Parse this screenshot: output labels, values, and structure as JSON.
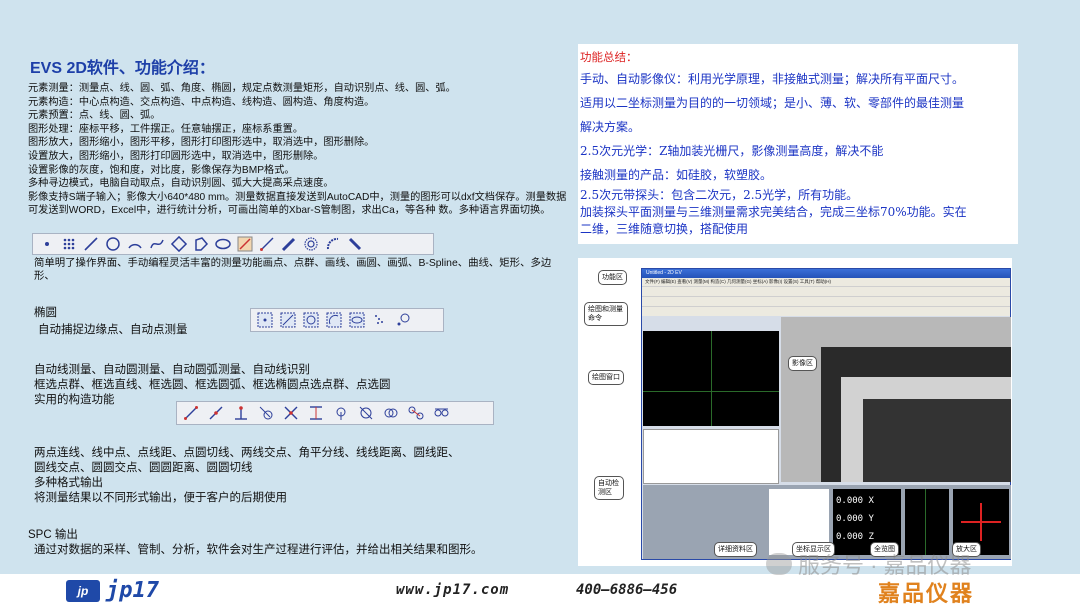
{
  "left": {
    "title": "EVS 2D软件、功能介绍：",
    "specs": [
      "元素测量：测量点、线、圆、弧、角度、椭圆，规定点数测量矩形，自动识别点、线、圆、弧。",
      "元素构造：中心点构造、交点构造、中点构造、线构造、圆构造、角度构造。",
      "元素预置：点、线、圆、弧。",
      "图形处理：座标平移，工件摆正。任意轴摆正，座标系重置。",
      "图形放大，图形缩小，图形平移，图形打印图形选中，取消选中，图形删除。",
      "设置放大，图形缩小，图形打印圆形选中，取消选中，图形删除。",
      "设置影像的灰度，饱和度，对比度，影像保存为BMP格式。",
      "多种寻边模式，电脑自动取点，自动识别圆、弧大大提高采点速度。",
      "影像支持S端子输入；影像大小640*480 mm。测量数据直接发送到AutoCAD中，测量的图形可以dxf文档保存。测量数据可发送到WORD，Excel中，进行统计分析，可画出简单的Xbar-S管制图，求出Ca，等各种 数。多种语言界面切换。"
    ],
    "ops_text": "简单明了操作界面、手动编程灵活丰富的测量功能画点、点群、画线、画圆、画弧、B-Spline、曲线、矩形、多边形、",
    "ellipse_title": "椭圆",
    "ellipse_desc": "自动捕捉边缘点、自动点测量",
    "construct_lines": [
      "自动线测量、自动圆测量、自动圆弧测量、自动线识别",
      "框选点群、框选直线、框选圆、框选圆弧、框选椭圆点选点群、点选圆",
      "实用的构造功能"
    ],
    "distance_lines": [
      "两点连线、线中点、点线距、点圆切线、两线交点、角平分线、线线距离、圆线距、",
      "圆线交点、圆圆交点、圆圆距离、圆圆切线"
    ],
    "output_title": "多种格式输出",
    "output_desc": "将测量结果以不同形式输出，便于客户的后期使用",
    "spc_title": "SPC 输出",
    "spc_desc": "通过对数据的采样、管制、分析，软件会对生产过程进行评估，并给出相关结果和图形。"
  },
  "right": {
    "summary_title": "功能总结：",
    "lines": [
      "手动、自动影像仪：利用光学原理，非接触式测量；解决所有平面尺寸。",
      "适用以二坐标测量为目的的一切领域；是小、薄、软、零部件的最佳测量",
      "解决方案。",
      "2.5次元光学：Z轴加装光栅尺，影像测量高度，解决不能",
      "接触测量的产品：如硅胶，软塑胶。",
      "2.5次元带探头：包含二次元，2.5光学，所有功能。",
      "加装探头平面测量与三维测量需求完美结合，完成三坐标70%功能。实在",
      "二维，三维随意切换，搭配使用"
    ]
  },
  "screenshot": {
    "window_title": "Untitled - 2D EV",
    "menu": "文件(F)  编辑(E)  查看(V)  测量(M)  构造(C)  几何测量(G)  坐标(A)  影像(I)  设置(S)  工具(T)  帮助(H)",
    "coords": [
      "0.000",
      "0.000",
      "0.000"
    ],
    "axis_labels": [
      "X",
      "Y",
      "Z"
    ],
    "callouts": {
      "func": "功能区",
      "draw_cmd": "绘图和测量命令",
      "draw_win": "绘图窗口",
      "auto_detect": "自动检测区",
      "image": "影像区",
      "detail": "详细资料区",
      "coord_disp": "坐标显示区",
      "full": "全览图",
      "zoom": "放大区"
    }
  },
  "footer": {
    "logo_mark": "jp",
    "logo_text": "jp17",
    "website": "www.jp17.com",
    "phone": "400—6886—456",
    "brand": "嘉品仪器",
    "watermark": "服务号 · 嘉品仪器"
  },
  "icons": {
    "toolbar1": [
      "point-icon",
      "point-cloud-icon",
      "line-icon",
      "circle-icon",
      "arc-icon",
      "curve-icon",
      "rectangle-icon",
      "polygon-icon",
      "ellipse-icon",
      "cross-icon",
      "line-measure-icon",
      "pen-icon",
      "ring-icon",
      "arc-auto-icon",
      "probe-icon"
    ],
    "toolbar2": [
      "box-point-icon",
      "box-line-icon",
      "box-circle-icon",
      "box-arc-icon",
      "box-ellipse-icon",
      "point-circle-icon"
    ],
    "toolbar3": [
      "line-icon",
      "midpoint-icon",
      "perp-icon",
      "tangent-icon",
      "intersect-icon",
      "distance-icon",
      "angle-icon",
      "circle-line-icon",
      "circle-circle-icon",
      "circle-dist-icon",
      "circle-tangent-icon"
    ]
  }
}
